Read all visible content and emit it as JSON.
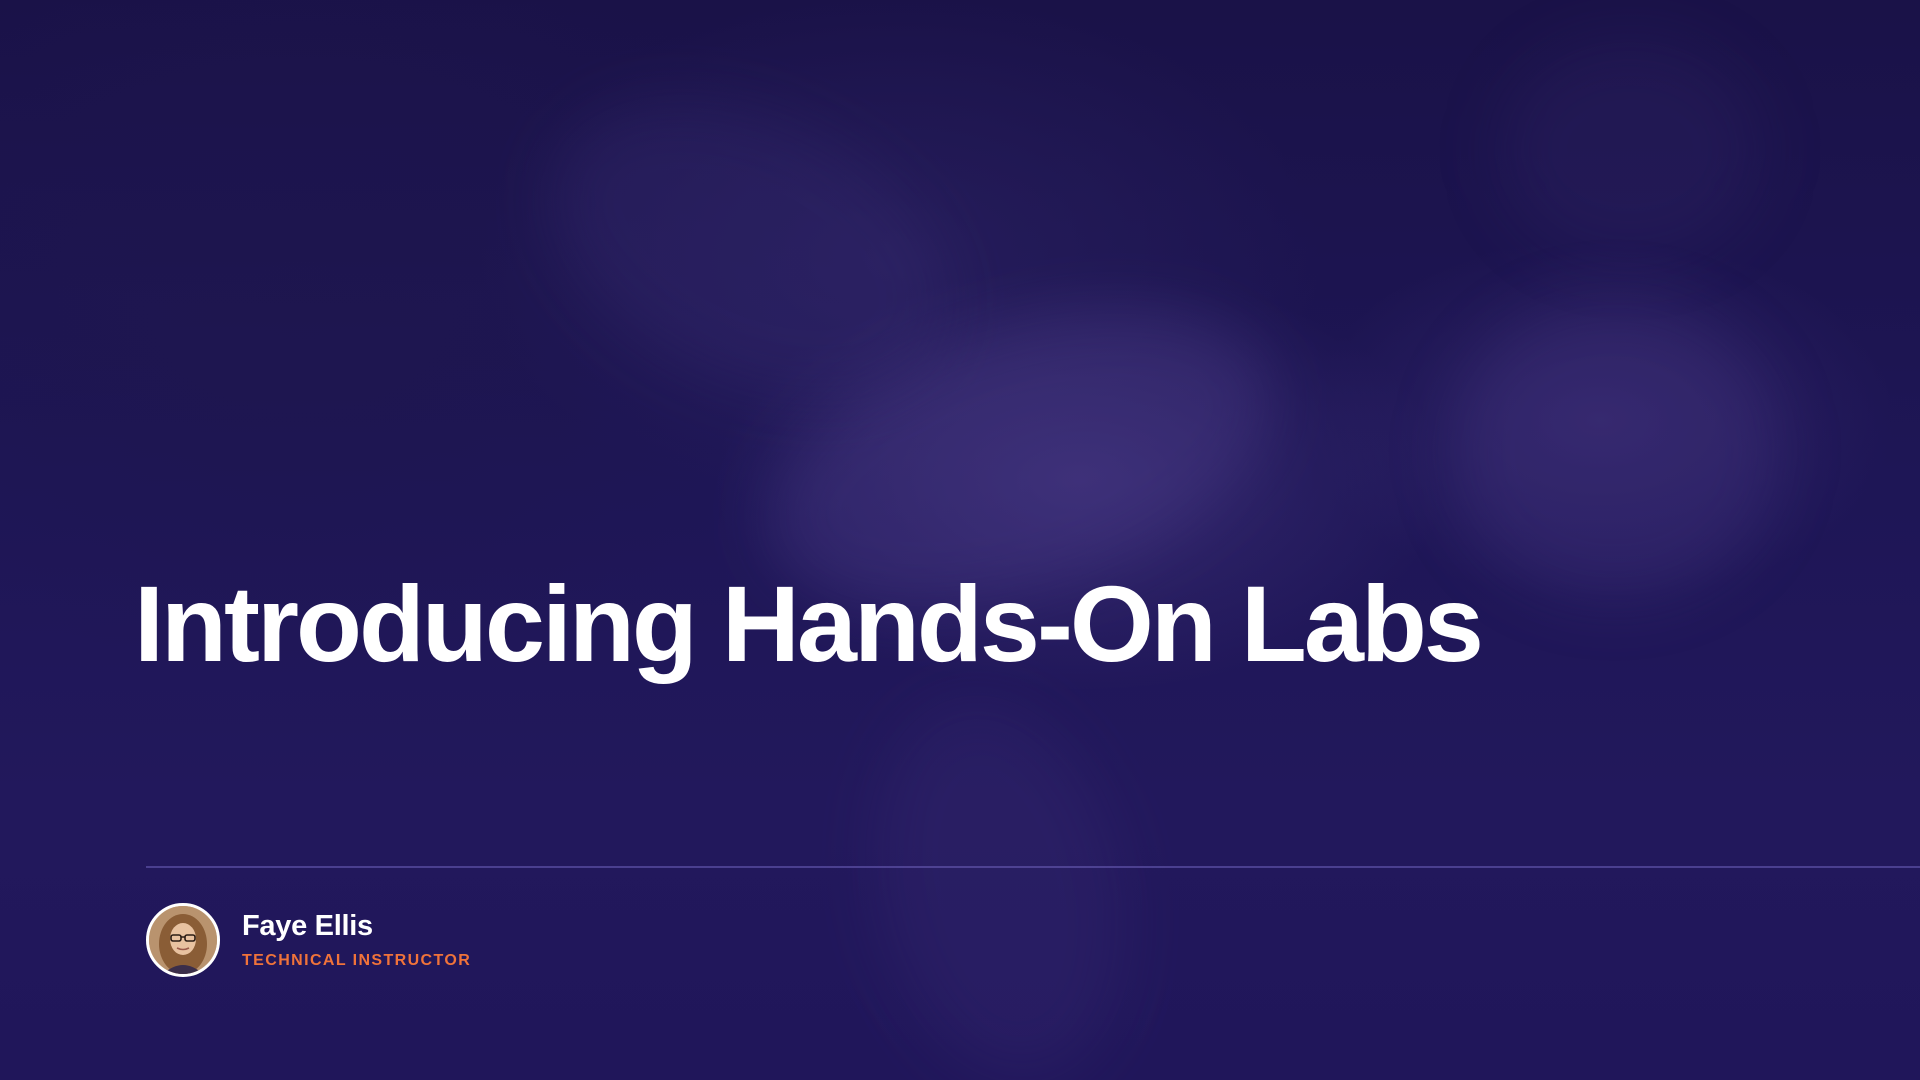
{
  "slide": {
    "title": "Introducing Hands-On Labs",
    "background_color": "#1e1656",
    "divider_color": "#5d52a8"
  },
  "presenter": {
    "name": "Faye Ellis",
    "role": "TECHNICAL INSTRUCTOR",
    "role_color": "#f0733a",
    "avatar_icon": "presenter-photo"
  }
}
